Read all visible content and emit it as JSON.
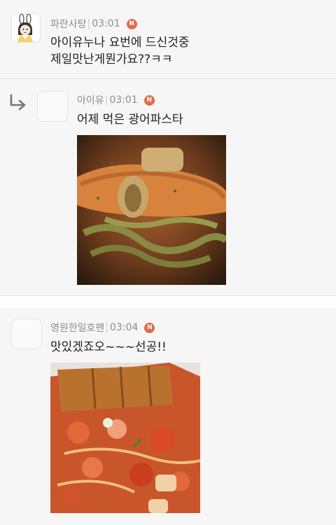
{
  "comments": [
    {
      "author": "파란사탕",
      "time": "03:01",
      "badge": "N",
      "text": "아이유누나 요번에 드신것중\n제일맛난게뭔가요??ㅋㅋ",
      "is_reply": false
    },
    {
      "author": "아이유",
      "time": "03:01",
      "badge": "N",
      "text": "어제 먹은 광어파스타",
      "is_reply": true,
      "photo": "pasta-photo"
    },
    {
      "author": "영원한일호팬",
      "time": "03:04",
      "badge": "N",
      "text": "맛있겠죠오~~~선공!!",
      "is_reply": false,
      "photo": "tteokbokki-photo"
    }
  ],
  "colors": {
    "badge": "#e4694c",
    "meta_text": "#8d8d8d",
    "background": "#f6f6f6"
  },
  "icons": [
    "reply-arrow-icon",
    "new-badge-icon",
    "avatar-bunny"
  ]
}
